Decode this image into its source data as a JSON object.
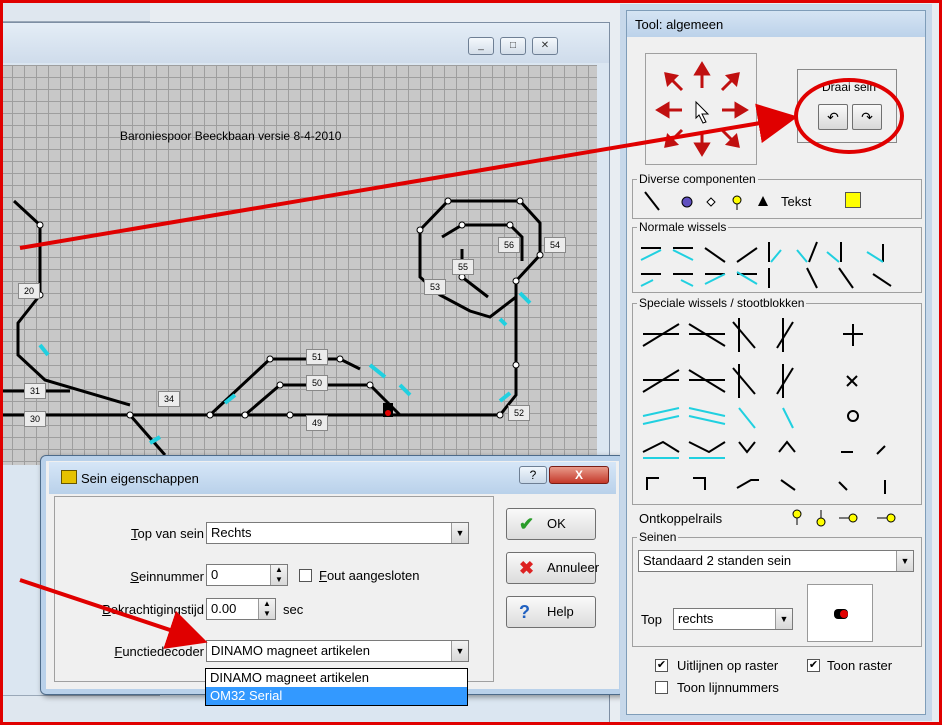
{
  "editor": {
    "canvas_title": "Baroniespoor Beeckbaan versie 8-4-2010",
    "window_buttons": [
      "_",
      "□",
      "✕"
    ],
    "track_labels": [
      {
        "id": "20",
        "text": "20"
      },
      {
        "id": "31",
        "text": "31"
      },
      {
        "id": "30",
        "text": "30"
      },
      {
        "id": "34",
        "text": "34"
      },
      {
        "id": "51",
        "text": "51"
      },
      {
        "id": "50",
        "text": "50"
      },
      {
        "id": "49",
        "text": "49"
      },
      {
        "id": "52",
        "text": "52"
      },
      {
        "id": "53",
        "text": "53"
      },
      {
        "id": "55",
        "text": "55"
      },
      {
        "id": "56",
        "text": "56"
      },
      {
        "id": "54",
        "text": "54"
      }
    ]
  },
  "dialog": {
    "title": "Sein eigenschappen",
    "help_glyph": "?",
    "close_glyph": "X",
    "top_van_sein": {
      "label_ul": "T",
      "label_rest": "op van sein",
      "value": "Rechts"
    },
    "seinnummer": {
      "label_ul": "S",
      "label_rest": "einnummer",
      "value": "0"
    },
    "fout_aangesloten": {
      "label_ul": "F",
      "label_rest": "out aangesloten",
      "checked": false
    },
    "bekrachtigingstijd": {
      "label_ul": "B",
      "label_rest": "ekrachtigingstijd",
      "value": "0.00",
      "unit": "sec"
    },
    "functiedecoder": {
      "label_ul": "F",
      "label_rest": "unctiedecoder",
      "value": "DINAMO magneet artikelen",
      "options": [
        "DINAMO magneet artikelen",
        "OM32 Serial"
      ]
    },
    "buttons": {
      "ok": "OK",
      "annuleer": "Annuleer",
      "help": "Help"
    }
  },
  "tool": {
    "title": "Tool: algemeen",
    "draai_sein": "Draai sein",
    "rotate_ccw": "↶",
    "rotate_cw": "↷",
    "diverse": {
      "title": "Diverse componenten",
      "tekst": "Tekst"
    },
    "normale_wissels": "Normale wissels",
    "speciale_wissels": "Speciale wissels / stootblokken",
    "ontkoppelrails": "Ontkoppelrails",
    "seinen": {
      "title": "Seinen",
      "type": "Standaard 2 standen sein",
      "top_label": "Top",
      "top_value": "rechts"
    },
    "uitlijnen": {
      "label": "Uitlijnen op raster",
      "checked": true
    },
    "toon_raster": {
      "label": "Toon raster",
      "checked": true
    },
    "toon_lijnnummers": {
      "label": "Toon lijnnummers",
      "checked": false
    }
  },
  "colors": {
    "annotation": "#e00000",
    "accent_track": "#20d0e0",
    "swatch": "#ffff00"
  }
}
